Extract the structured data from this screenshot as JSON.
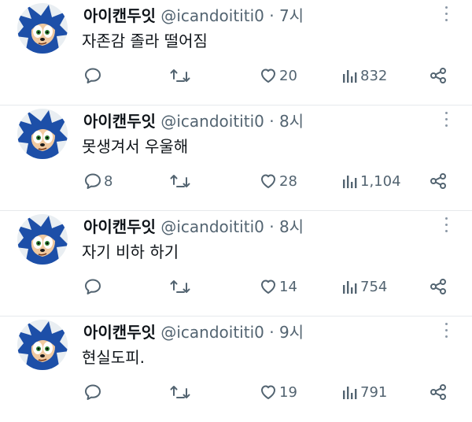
{
  "colors": {
    "text": "#0f1419",
    "secondary": "#536471",
    "divider": "#e6e9ec"
  },
  "icons": {
    "avatar": "sonic-avatar-icon",
    "reply": "reply-icon",
    "retweet": "retweet-icon",
    "like": "heart-icon",
    "views": "views-chart-icon",
    "share": "share-icon",
    "more": "more-dots-icon"
  },
  "tweets": [
    {
      "author": "아이캔두잇",
      "handle": "@icandoititi0",
      "time": "7시",
      "text": "자존감 졸라 떨어짐",
      "replies": "",
      "retweets": "",
      "likes": "20",
      "views": "832"
    },
    {
      "author": "아이캔두잇",
      "handle": "@icandoititi0",
      "time": "8시",
      "text": "못생겨서 우울해",
      "replies": "8",
      "retweets": "",
      "likes": "28",
      "views": "1,104"
    },
    {
      "author": "아이캔두잇",
      "handle": "@icandoititi0",
      "time": "8시",
      "text": "자기 비하 하기",
      "replies": "",
      "retweets": "",
      "likes": "14",
      "views": "754"
    },
    {
      "author": "아이캔두잇",
      "handle": "@icandoititi0",
      "time": "9시",
      "text": "현실도피.",
      "replies": "",
      "retweets": "",
      "likes": "19",
      "views": "791"
    }
  ]
}
